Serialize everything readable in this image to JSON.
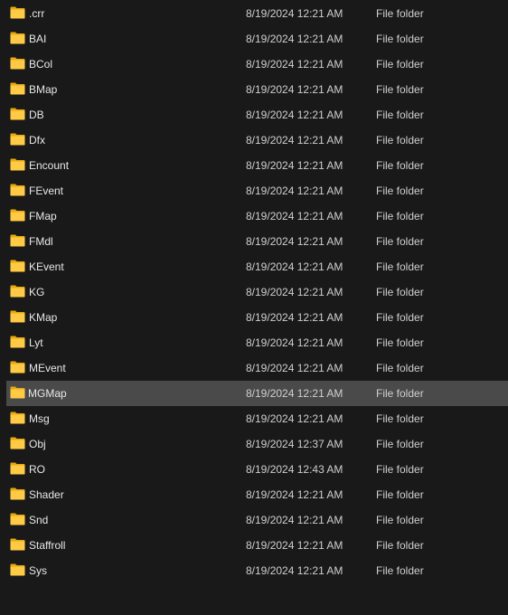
{
  "folder_icon_colors": {
    "back": "#E8A90F",
    "front": "#FFCA45"
  },
  "selected_index": 15,
  "rows": [
    {
      "name": ".crr",
      "date": "8/19/2024 12:21 AM",
      "type": "File folder"
    },
    {
      "name": "BAI",
      "date": "8/19/2024 12:21 AM",
      "type": "File folder"
    },
    {
      "name": "BCol",
      "date": "8/19/2024 12:21 AM",
      "type": "File folder"
    },
    {
      "name": "BMap",
      "date": "8/19/2024 12:21 AM",
      "type": "File folder"
    },
    {
      "name": "DB",
      "date": "8/19/2024 12:21 AM",
      "type": "File folder"
    },
    {
      "name": "Dfx",
      "date": "8/19/2024 12:21 AM",
      "type": "File folder"
    },
    {
      "name": "Encount",
      "date": "8/19/2024 12:21 AM",
      "type": "File folder"
    },
    {
      "name": "FEvent",
      "date": "8/19/2024 12:21 AM",
      "type": "File folder"
    },
    {
      "name": "FMap",
      "date": "8/19/2024 12:21 AM",
      "type": "File folder"
    },
    {
      "name": "FMdl",
      "date": "8/19/2024 12:21 AM",
      "type": "File folder"
    },
    {
      "name": "KEvent",
      "date": "8/19/2024 12:21 AM",
      "type": "File folder"
    },
    {
      "name": "KG",
      "date": "8/19/2024 12:21 AM",
      "type": "File folder"
    },
    {
      "name": "KMap",
      "date": "8/19/2024 12:21 AM",
      "type": "File folder"
    },
    {
      "name": "Lyt",
      "date": "8/19/2024 12:21 AM",
      "type": "File folder"
    },
    {
      "name": "MEvent",
      "date": "8/19/2024 12:21 AM",
      "type": "File folder"
    },
    {
      "name": "MGMap",
      "date": "8/19/2024 12:21 AM",
      "type": "File folder"
    },
    {
      "name": "Msg",
      "date": "8/19/2024 12:21 AM",
      "type": "File folder"
    },
    {
      "name": "Obj",
      "date": "8/19/2024 12:37 AM",
      "type": "File folder"
    },
    {
      "name": "RO",
      "date": "8/19/2024 12:43 AM",
      "type": "File folder"
    },
    {
      "name": "Shader",
      "date": "8/19/2024 12:21 AM",
      "type": "File folder"
    },
    {
      "name": "Snd",
      "date": "8/19/2024 12:21 AM",
      "type": "File folder"
    },
    {
      "name": "Staffroll",
      "date": "8/19/2024 12:21 AM",
      "type": "File folder"
    },
    {
      "name": "Sys",
      "date": "8/19/2024 12:21 AM",
      "type": "File folder"
    }
  ]
}
